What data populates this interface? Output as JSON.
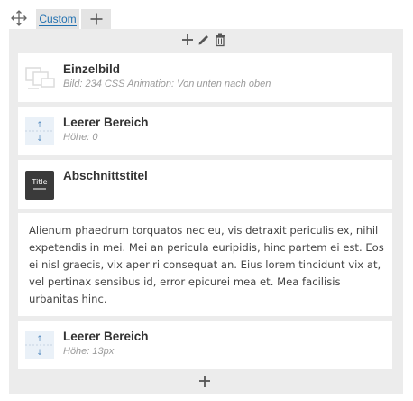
{
  "toolbar": {
    "move_icon": "move-arrows-icon",
    "tab_label": "Custom",
    "add_icon": "plus-icon"
  },
  "column_tools": {
    "icons": [
      "plus-icon",
      "pencil-icon",
      "trash-icon"
    ]
  },
  "blocks": [
    {
      "type": "image",
      "icon": "image-placeholder-icon",
      "title": "Einzelbild",
      "subtitle": "Bild: 234  CSS Animation: Von unten nach oben"
    },
    {
      "type": "spacer",
      "icon": "spacer-icon",
      "title": "Leerer Bereich",
      "subtitle": "Höhe: 0"
    },
    {
      "type": "heading",
      "icon": "title-icon",
      "icon_text": "Title",
      "title": "Abschnittstitel"
    },
    {
      "type": "text",
      "text": "Alienum phaedrum torquatos nec eu, vis detraxit periculis ex, nihil expetendis in mei. Mei an pericula euripidis, hinc partem ei est. Eos ei nisl graecis, vix aperiri consequat an. Eius lorem tincidunt vix at, vel pertinax sensibus id, error epicurei mea et. Mea facilisis urbanitas hinc."
    },
    {
      "type": "spacer",
      "icon": "spacer-icon",
      "title": "Leerer Bereich",
      "subtitle": "Höhe: 13px"
    }
  ],
  "footer": {
    "add_icon": "plus-icon"
  },
  "colors": {
    "container_bg": "#ececec",
    "tab_bg": "#e4e4e4",
    "link": "#2271b1",
    "title_icon_bg": "#3a3a3a"
  }
}
